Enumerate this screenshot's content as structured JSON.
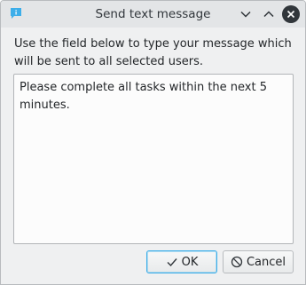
{
  "window": {
    "title": "Send text message",
    "icons": {
      "app": "chat-bubble-icon",
      "minimize": "chevron-down-icon",
      "maximize": "chevron-up-icon",
      "close": "close-icon"
    }
  },
  "content": {
    "description": "Use the field below to type your message which will be sent to all selected users.",
    "message_value": "Please complete all tasks within the next 5 minutes."
  },
  "buttons": {
    "ok_label": "OK",
    "ok_icon": "checkmark-icon",
    "cancel_label": "Cancel",
    "cancel_icon": "cancel-icon"
  },
  "colors": {
    "accent": "#3daee9",
    "window_bg": "#eff0f1",
    "titlebar_bg": "#e3e5e7"
  }
}
